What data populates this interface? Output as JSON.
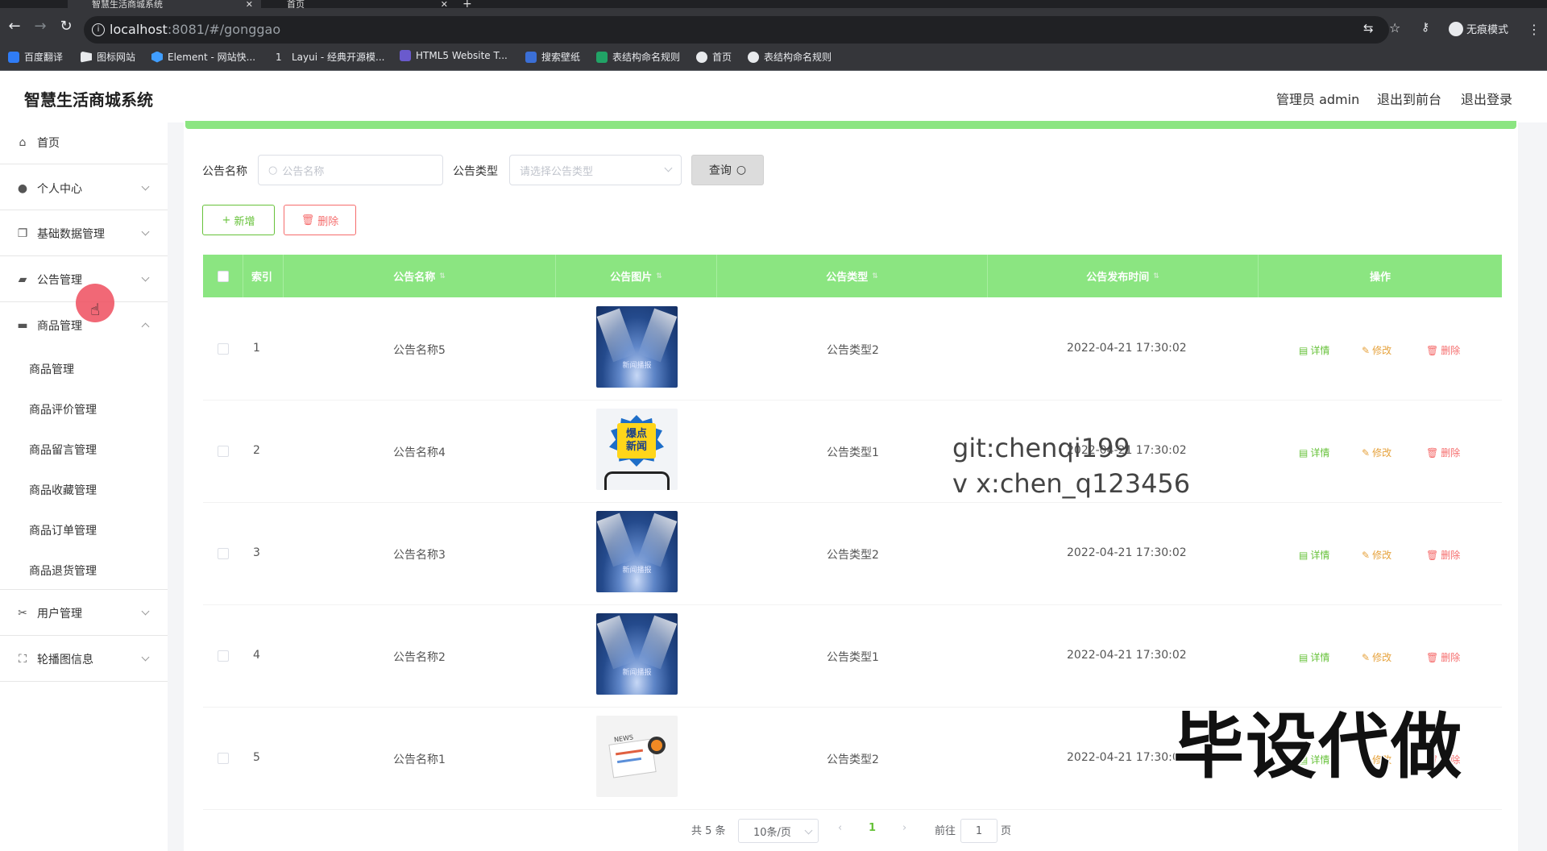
{
  "browser": {
    "tabs": [
      {
        "title": "智慧生活商城系统",
        "active": true
      },
      {
        "title": "首页",
        "active": false
      }
    ],
    "url_host": "localhost",
    "url_rest": ":8081/#/gonggao",
    "incognito_label": "无痕模式",
    "bookmarks": [
      {
        "label": "百度翻译",
        "color": "#2f7cf6"
      },
      {
        "label": "图标网站",
        "color": "#e8eaed"
      },
      {
        "label": "Element - 网站快...",
        "color": "#409eff"
      },
      {
        "label": "Layui - 经典开源模...",
        "color": "#e8eaed"
      },
      {
        "label": "HTML5 Website T...",
        "color": "#6a5acd"
      },
      {
        "label": "搜索壁纸",
        "color": "#3b6fd6"
      },
      {
        "label": "表结构命名规则",
        "color": "#21a366"
      },
      {
        "label": "首页",
        "color": "#e8eaed"
      },
      {
        "label": "表结构命名规则",
        "color": "#e8eaed"
      }
    ]
  },
  "header": {
    "app_title": "智慧生活商城系统",
    "admin_label": "管理员 admin",
    "front_link": "退出到前台",
    "logout_link": "退出登录"
  },
  "sidebar": {
    "items": [
      {
        "label": "首页",
        "icon": "home-icon"
      },
      {
        "label": "个人中心",
        "icon": "user-icon"
      },
      {
        "label": "基础数据管理",
        "icon": "copy-icon"
      },
      {
        "label": "公告管理",
        "icon": "bus-icon"
      },
      {
        "label": "商品管理",
        "icon": "monitor-icon"
      },
      {
        "label": "用户管理",
        "icon": "cut-icon"
      },
      {
        "label": "轮播图信息",
        "icon": "full-screen-icon"
      }
    ],
    "sub_items": [
      "商品管理",
      "商品评价管理",
      "商品留言管理",
      "商品收藏管理",
      "商品订单管理",
      "商品退货管理"
    ]
  },
  "search": {
    "name_label": "公告名称",
    "name_placeholder": "公告名称",
    "type_label": "公告类型",
    "type_placeholder": "请选择公告类型",
    "query_button": "查询"
  },
  "actions": {
    "add_button": "新增",
    "delete_button": "删除"
  },
  "table": {
    "columns": [
      "索引",
      "公告名称",
      "公告图片",
      "公告类型",
      "公告发布时间",
      "操作"
    ],
    "rows": [
      {
        "index": "1",
        "name": "公告名称5",
        "image": "spotlight",
        "type": "公告类型2",
        "time": "2022-04-21 17:30:02"
      },
      {
        "index": "2",
        "name": "公告名称4",
        "image": "burst",
        "type": "公告类型1",
        "time": "2022-04-21 17:30:02"
      },
      {
        "index": "3",
        "name": "公告名称3",
        "image": "spotlight",
        "type": "公告类型2",
        "time": "2022-04-21 17:30:02"
      },
      {
        "index": "4",
        "name": "公告名称2",
        "image": "spotlight",
        "type": "公告类型1",
        "time": "2022-04-21 17:30:02"
      },
      {
        "index": "5",
        "name": "公告名称1",
        "image": "news",
        "type": "公告类型2",
        "time": "2022-04-21 17:30:02"
      }
    ],
    "ops": {
      "detail": "详情",
      "edit": "修改",
      "delete": "删除"
    },
    "image_captions": {
      "spotlight": "新闻播报",
      "burst_top": "爆点",
      "burst_bottom": "新闻",
      "news": "NEWS"
    }
  },
  "watermark": {
    "line1": "git:chenqi199",
    "line2": "v x:chen_q123456",
    "big": "毕设代做"
  },
  "pagination": {
    "total": "共 5 条",
    "page_size": "10条/页",
    "current_page": "1",
    "goto_label": "前往",
    "goto_value": "1",
    "page_suffix": "页"
  },
  "colors": {
    "accent": "#8be581",
    "success": "#67c23a",
    "warning": "#e6a23c",
    "danger": "#f56c6c"
  }
}
